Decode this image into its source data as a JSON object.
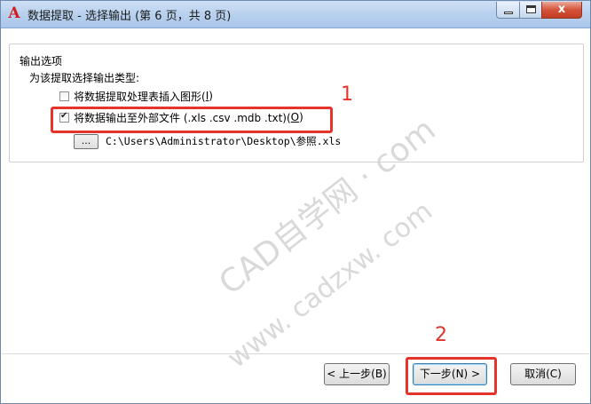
{
  "window": {
    "title": "数据提取 - 选择输出 (第 6 页，共 8 页)",
    "app_icon_letter": "A",
    "close_glyph": "x"
  },
  "group": {
    "title": "输出选项",
    "description": "为该提取选择输出类型:"
  },
  "options": [
    {
      "label": "将数据提取处理表插入图形(",
      "mnemonic": "I",
      "tail": ")",
      "checked": false
    },
    {
      "label": "将数据输出至外部文件  (.xls .csv .mdb .txt)(",
      "mnemonic": "O",
      "tail": ")",
      "checked": true
    }
  ],
  "browse_button": "...",
  "file_path": "C:\\Users\\Administrator\\Desktop\\参照.xls",
  "annotations": [
    "1",
    "2"
  ],
  "watermark": {
    "line1": "CAD自学网 · com",
    "line2": "www. cadzxw. com"
  },
  "buttons": {
    "back": "< 上一步(B)",
    "next": "下一步(N) >",
    "cancel": "取消(C)"
  },
  "colors": {
    "annotation": "#e4342c",
    "title_bar": "#b9d1ee",
    "close_button": "#d4533a"
  }
}
